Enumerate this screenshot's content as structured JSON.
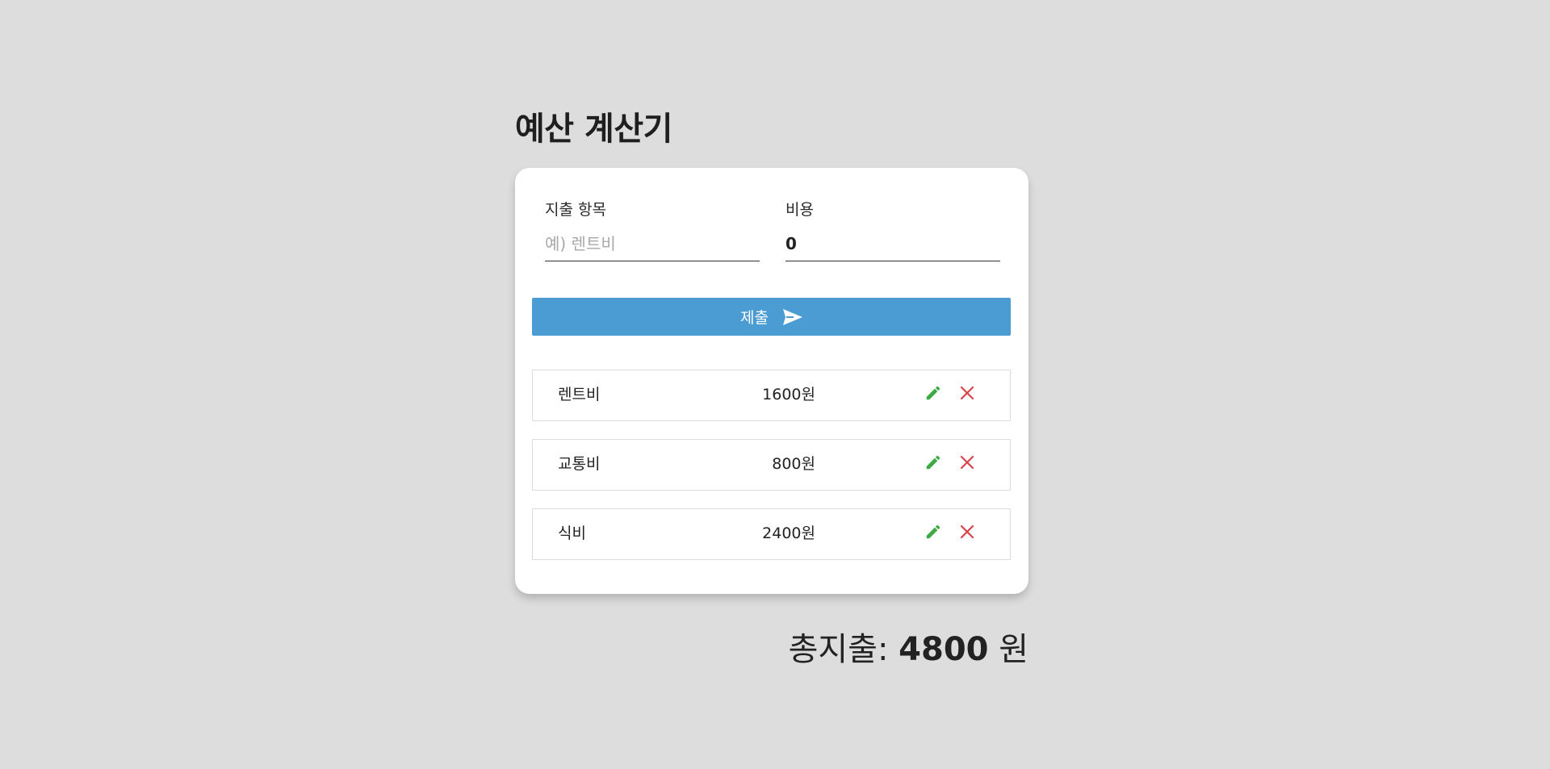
{
  "page": {
    "title": "예산 계산기"
  },
  "form": {
    "item_label": "지출 항목",
    "item_placeholder": "예) 렌트비",
    "item_value": "",
    "cost_label": "비용",
    "cost_value": "0",
    "submit_label": "제출",
    "submit_icon": "send-icon"
  },
  "expenses": [
    {
      "name": "렌트비",
      "amount": "1600원"
    },
    {
      "name": "교통비",
      "amount": "800원"
    },
    {
      "name": "식비",
      "amount": "2400원"
    }
  ],
  "row_actions": {
    "edit_icon": "pencil-icon",
    "delete_icon": "close-icon"
  },
  "total": {
    "label": "총지출: ",
    "value": "4800",
    "unit": " 원"
  },
  "colors": {
    "background": "#dddddd",
    "card": "#ffffff",
    "accent": "#4b9cd3",
    "edit": "#3daa43",
    "delete": "#d9434a"
  }
}
